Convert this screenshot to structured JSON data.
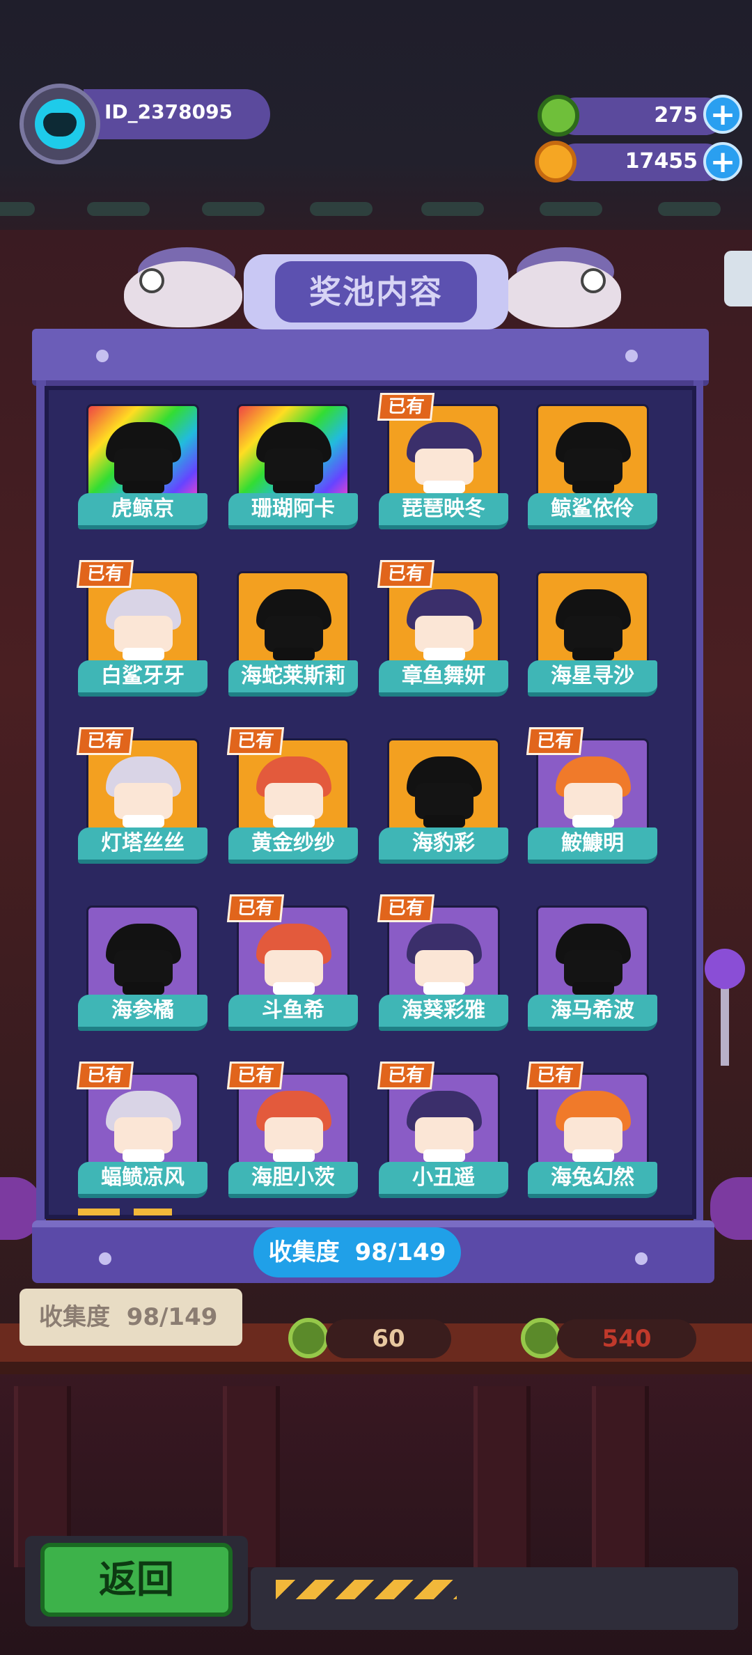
{
  "player": {
    "id": "ID_2378095"
  },
  "currencies": [
    {
      "name": "green-coin",
      "value": "275",
      "color": "#6fbf3a"
    },
    {
      "name": "gold-planet",
      "value": "17455",
      "color": "#f5a623"
    }
  ],
  "panel": {
    "title": "奖池内容",
    "owned_badge": "已有",
    "collection_label": "收集度",
    "collection_value": "98/149",
    "items": [
      {
        "name": "虎鲸京",
        "owned": false,
        "bg": "rainbow"
      },
      {
        "name": "珊瑚阿卡",
        "owned": false,
        "bg": "rainbow"
      },
      {
        "name": "琵琶映冬",
        "owned": true,
        "bg": "orange"
      },
      {
        "name": "鲸鲨依伶",
        "owned": false,
        "bg": "orange"
      },
      {
        "name": "白鲨牙牙",
        "owned": true,
        "bg": "orange"
      },
      {
        "name": "海蛇莱斯莉",
        "owned": false,
        "bg": "orange"
      },
      {
        "name": "章鱼舞妍",
        "owned": true,
        "bg": "orange"
      },
      {
        "name": "海星寻沙",
        "owned": false,
        "bg": "orange"
      },
      {
        "name": "灯塔丝丝",
        "owned": true,
        "bg": "orange"
      },
      {
        "name": "黄金纱纱",
        "owned": true,
        "bg": "orange"
      },
      {
        "name": "海豹彩",
        "owned": false,
        "bg": "orange"
      },
      {
        "name": "鮟鱇明",
        "owned": true,
        "bg": "purple"
      },
      {
        "name": "海参橘",
        "owned": false,
        "bg": "purple"
      },
      {
        "name": "斗鱼希",
        "owned": true,
        "bg": "purple"
      },
      {
        "name": "海葵彩雅",
        "owned": true,
        "bg": "purple"
      },
      {
        "name": "海马希波",
        "owned": false,
        "bg": "purple"
      },
      {
        "name": "蝠鲼凉风",
        "owned": true,
        "bg": "purple"
      },
      {
        "name": "海胆小茨",
        "owned": true,
        "bg": "purple"
      },
      {
        "name": "小丑遥",
        "owned": true,
        "bg": "purple"
      },
      {
        "name": "海兔幻然",
        "owned": true,
        "bg": "purple"
      }
    ]
  },
  "background": {
    "collection_label": "收集度",
    "collection_value": "98/149",
    "price_1": "60",
    "price_2": "540"
  },
  "back_button": "返回"
}
